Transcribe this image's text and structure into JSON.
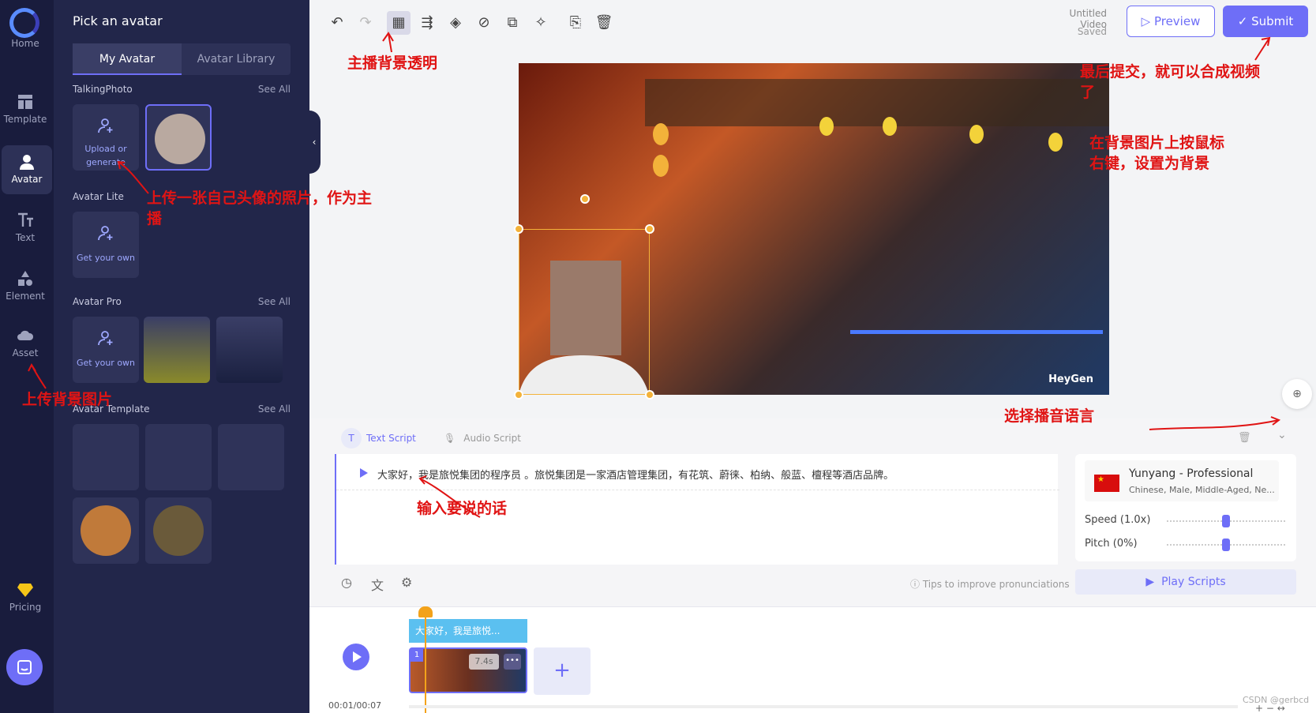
{
  "nav": {
    "items": [
      {
        "label": "Home",
        "icon": "home-icon"
      },
      {
        "label": "Template",
        "icon": "template-icon"
      },
      {
        "label": "Avatar",
        "icon": "avatar-icon",
        "active": true
      },
      {
        "label": "Text",
        "icon": "text-icon"
      },
      {
        "label": "Element",
        "icon": "element-icon"
      },
      {
        "label": "Asset",
        "icon": "asset-icon"
      },
      {
        "label": "Pricing",
        "icon": "diamond-icon"
      }
    ]
  },
  "panel": {
    "title": "Pick an avatar",
    "tabs": [
      "My Avatar",
      "Avatar Library"
    ],
    "sections": {
      "talking_photo": {
        "title": "TalkingPhoto",
        "see_all": "See All",
        "upload_label": "Upload or generate"
      },
      "avatar_lite": {
        "title": "Avatar Lite",
        "get_own": "Get your own"
      },
      "avatar_pro": {
        "title": "Avatar Pro",
        "see_all": "See All",
        "get_own": "Get your own"
      },
      "avatar_template": {
        "title": "Avatar Template",
        "see_all": "See All"
      }
    }
  },
  "toolbar": {
    "video_name": "Untitled Video",
    "save_state": "Saved",
    "preview_label": "Preview",
    "submit_label": "Submit"
  },
  "canvas": {
    "watermark": "HeyGen"
  },
  "script": {
    "tab_text": "Text Script",
    "tab_audio": "Audio Script",
    "line": "大家好，我是旅悦集团的程序员        。旅悦集团是一家酒店管理集团，有花筑、蔚徕、柏纳、般蓝、檀程等酒店品牌。",
    "tips": "Tips to improve pronunciations"
  },
  "voice": {
    "name": "Yunyang - Professional",
    "desc": "Chinese, Male, Middle-Aged, Ne...",
    "speed_label": "Speed (1.0x)",
    "pitch_label": "Pitch (0%)",
    "speed_value": 0.5,
    "pitch_value": 0.5,
    "play_label": "Play Scripts"
  },
  "timeline": {
    "text_clip": "大家好，我是旅悦...",
    "clip_number": "1",
    "clip_duration": "7.4s",
    "time": "00:01/00:07",
    "credit": "CSDN @gerbcd"
  },
  "annotations": {
    "bg_transparent": "主播背景透明",
    "submit_note": "最后提交，就可以合成视频了",
    "bg_note": "在背景图片上按鼠标右键，设置为背景",
    "upload_photo_note": "上传一张自己头像的照片，作为主播",
    "upload_bg_note": "上传背景图片",
    "select_lang_note": "选择播音语言",
    "input_text_note": "输入要说的话"
  }
}
